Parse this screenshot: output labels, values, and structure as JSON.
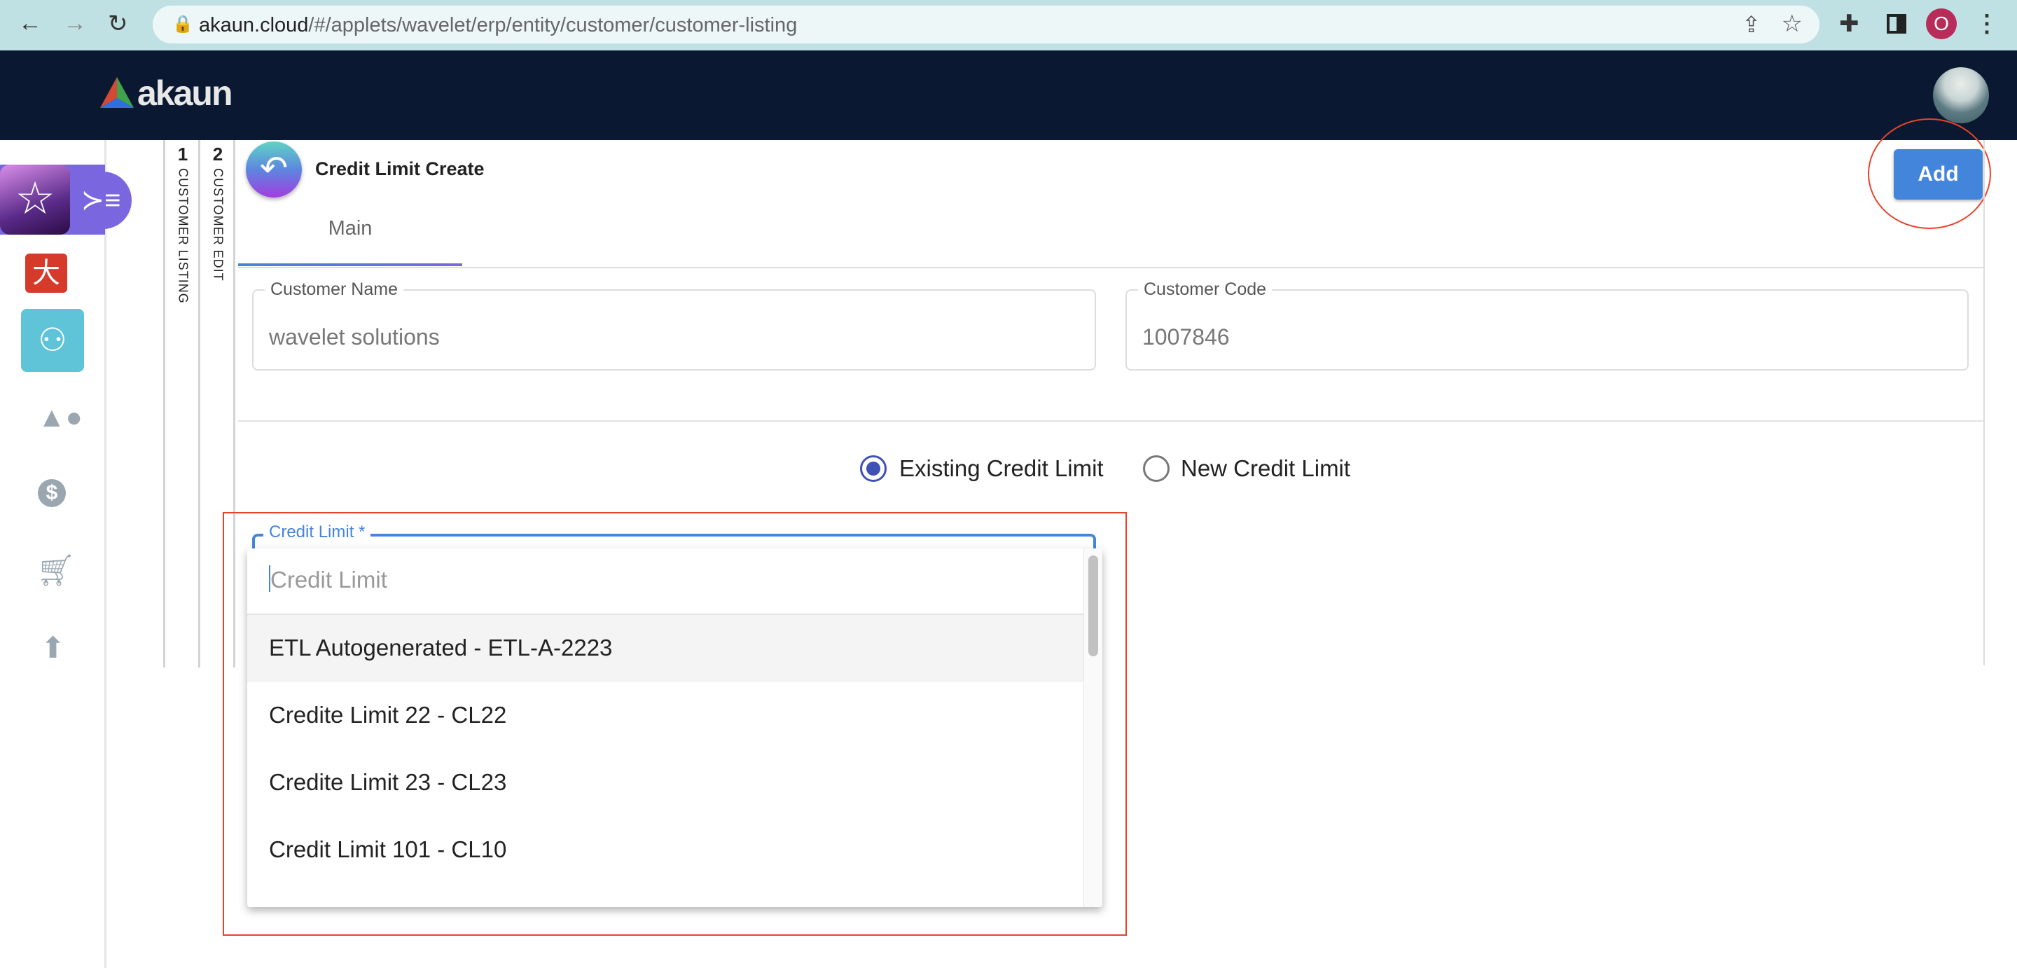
{
  "browser": {
    "url_host": "akaun.cloud",
    "url_path": "/#/applets/wavelet/erp/entity/customer/customer-listing",
    "profile_initial": "O"
  },
  "header": {
    "logo_text": "akaun"
  },
  "sidebar": {
    "icons": [
      "applet-star-icon",
      "menu-expand-icon",
      "red-app-icon",
      "person-icon",
      "shapes-icon",
      "dollar-icon",
      "cart-icon",
      "upload-icon"
    ]
  },
  "breadcrumb_tabs": [
    {
      "num": "1",
      "label": "CUSTOMER LISTING"
    },
    {
      "num": "2",
      "label": "CUSTOMER EDIT"
    }
  ],
  "page": {
    "title": "Credit Limit Create",
    "add_label": "Add",
    "tab_main": "Main"
  },
  "form": {
    "customer_name_label": "Customer Name",
    "customer_name_value": "wavelet solutions",
    "customer_code_label": "Customer Code",
    "customer_code_value": "1007846",
    "radio_existing": "Existing Credit Limit",
    "radio_new": "New Credit Limit",
    "selected_radio": "existing",
    "credit_limit_label": "Credit Limit *",
    "dropdown": {
      "search_placeholder": "Credit Limit",
      "options": [
        "ETL Autogenerated - ETL-A-2223",
        "Credite Limit 22 - CL22",
        "Credite Limit 23 - CL23",
        "Credit Limit 101 - CL10"
      ]
    }
  },
  "colors": {
    "accent": "#4485dc",
    "header": "#0a1931",
    "annotation": "#e8432a",
    "active_sidebar": "#5fc4d8"
  }
}
